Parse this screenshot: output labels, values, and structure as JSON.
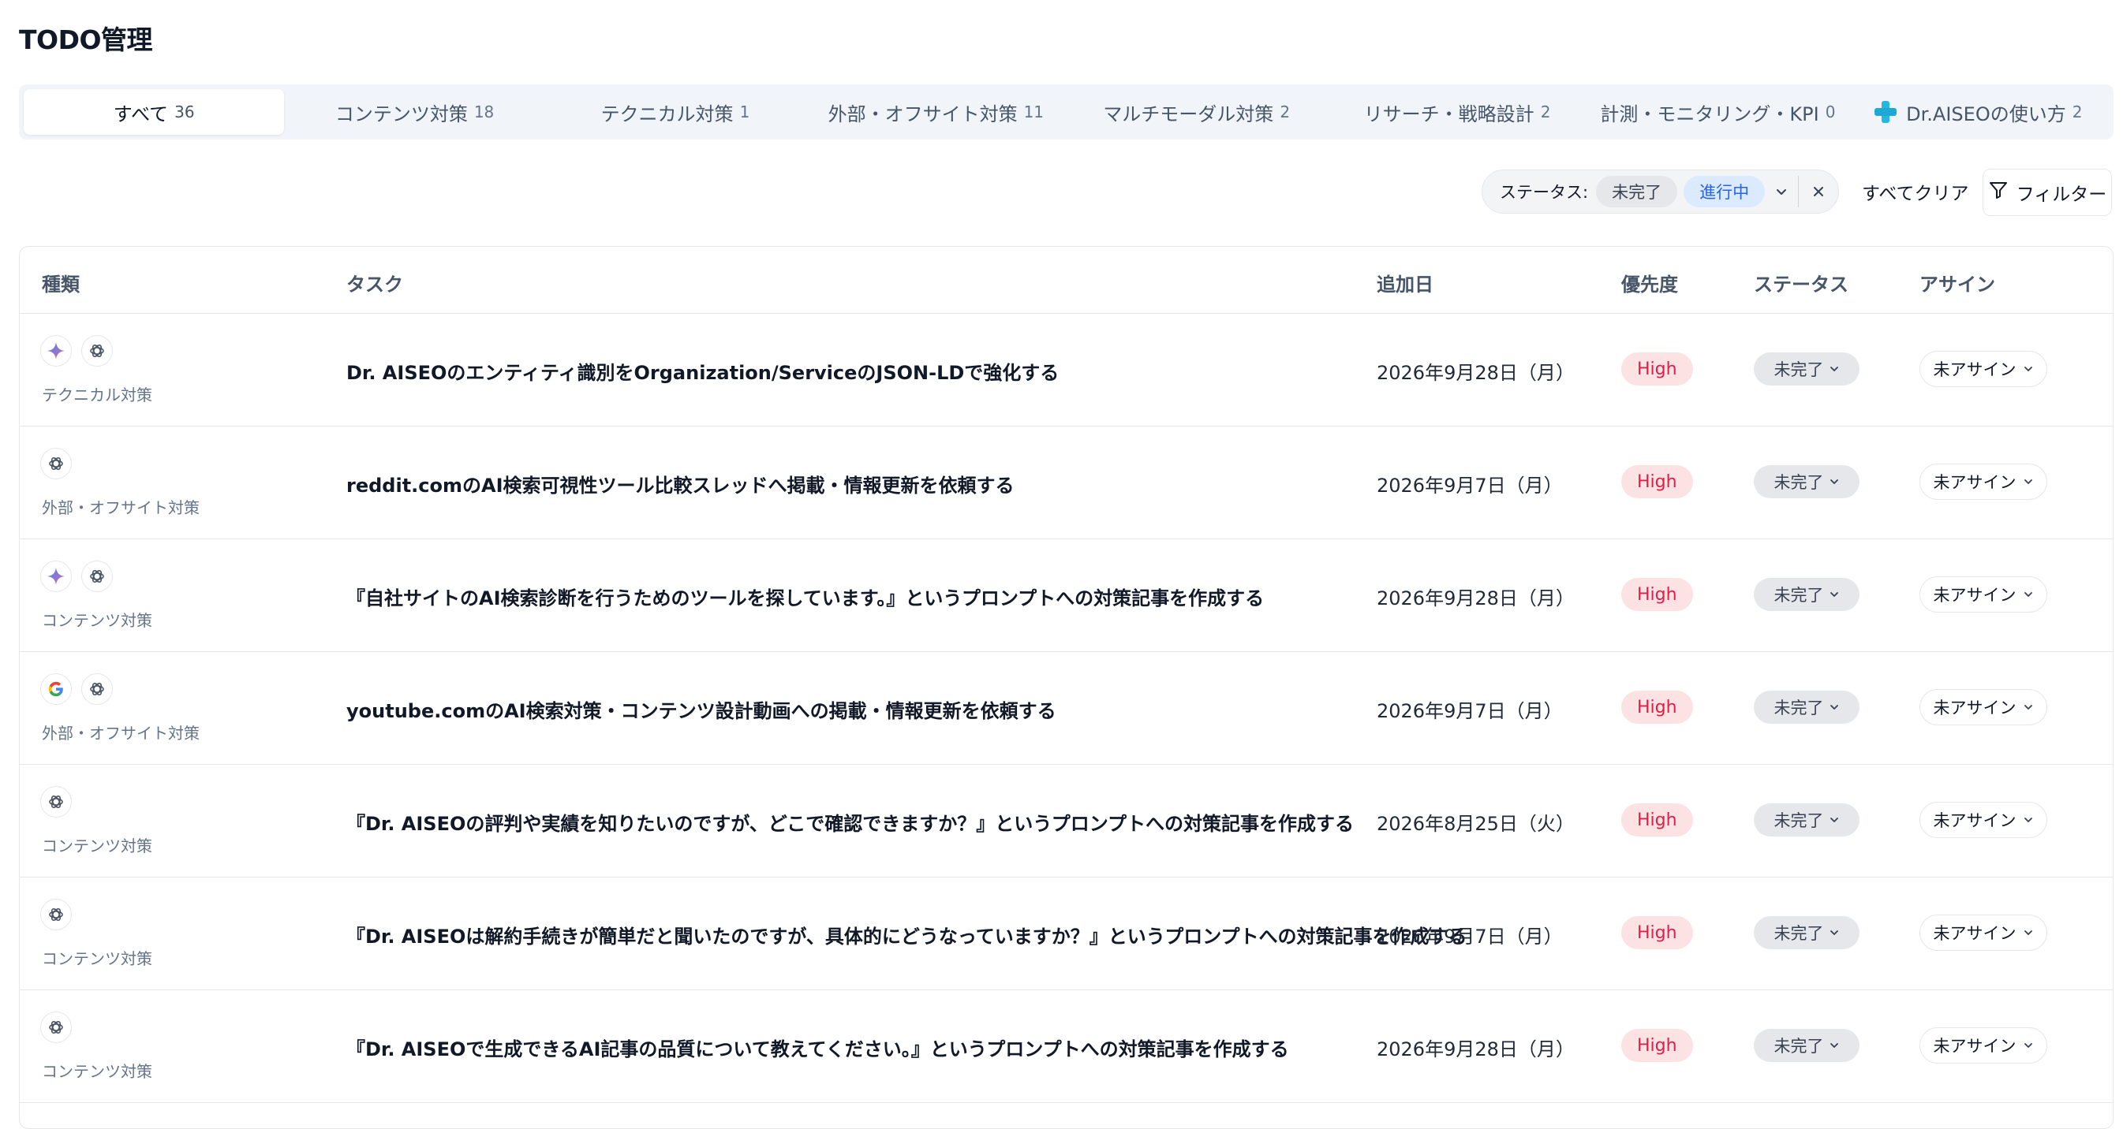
{
  "page": {
    "title": "TODO管理"
  },
  "tabs": [
    {
      "label": "すべて",
      "count": "36"
    },
    {
      "label": "コンテンツ対策",
      "count": "18"
    },
    {
      "label": "テクニカル対策",
      "count": "1"
    },
    {
      "label": "外部・オフサイト対策",
      "count": "11"
    },
    {
      "label": "マルチモーダル対策",
      "count": "2"
    },
    {
      "label": "リサーチ・戦略設計",
      "count": "2"
    },
    {
      "label": "計測・モニタリング・KPI",
      "count": "0"
    },
    {
      "label": "Dr.AISEOの使い方",
      "count": "2"
    }
  ],
  "filters": {
    "status_label": "ステータス:",
    "chips": [
      "未完了",
      "進行中"
    ],
    "clear_all": "すべてクリア",
    "filter_button": "フィルター"
  },
  "table": {
    "headers": {
      "type": "種類",
      "task": "タスク",
      "added": "追加日",
      "priority": "優先度",
      "status": "ステータス",
      "assign": "アサイン"
    },
    "rows": [
      {
        "type": "テクニカル対策",
        "icons": [
          "gemini-icon",
          "openai-icon"
        ],
        "task": "Dr. AISEOのエンティティ識別をOrganization/ServiceのJSON-LDで強化する",
        "date": "2026年9月28日（月）",
        "priority": "High",
        "status": "未完了",
        "assign": "未アサイン"
      },
      {
        "type": "外部・オフサイト対策",
        "icons": [
          "openai-icon"
        ],
        "task": "reddit.comのAI検索可視性ツール比較スレッドへ掲載・情報更新を依頼する",
        "date": "2026年9月7日（月）",
        "priority": "High",
        "status": "未完了",
        "assign": "未アサイン"
      },
      {
        "type": "コンテンツ対策",
        "icons": [
          "gemini-icon",
          "openai-icon"
        ],
        "task": "『自社サイトのAI検索診断を行うためのツールを探しています。』というプロンプトへの対策記事を作成する",
        "date": "2026年9月28日（月）",
        "priority": "High",
        "status": "未完了",
        "assign": "未アサイン"
      },
      {
        "type": "外部・オフサイト対策",
        "icons": [
          "google-icon",
          "openai-icon"
        ],
        "task": "youtube.comのAI検索対策・コンテンツ設計動画への掲載・情報更新を依頼する",
        "date": "2026年9月7日（月）",
        "priority": "High",
        "status": "未完了",
        "assign": "未アサイン"
      },
      {
        "type": "コンテンツ対策",
        "icons": [
          "openai-icon"
        ],
        "task": "『Dr. AISEOの評判や実績を知りたいのですが、どこで確認できますか？』というプロンプトへの対策記事を作成する",
        "date": "2026年8月25日（火）",
        "priority": "High",
        "status": "未完了",
        "assign": "未アサイン"
      },
      {
        "type": "コンテンツ対策",
        "icons": [
          "openai-icon"
        ],
        "task": "『Dr. AISEOは解約手続きが簡単だと聞いたのですが、具体的にどうなっていますか？』というプロンプトへの対策記事を作成する",
        "date": "2026年9月7日（月）",
        "priority": "High",
        "status": "未完了",
        "assign": "未アサイン"
      },
      {
        "type": "コンテンツ対策",
        "icons": [
          "openai-icon"
        ],
        "task": "『Dr. AISEOで生成できるAI記事の品質について教えてください。』というプロンプトへの対策記事を作成する",
        "date": "2026年9月28日（月）",
        "priority": "High",
        "status": "未完了",
        "assign": "未アサイン"
      }
    ]
  },
  "colors": {
    "priority_high_bg": "#fde2e4",
    "priority_high_text": "#e11d48",
    "chip_active_bg": "#dbeafe",
    "chip_active_text": "#2563eb"
  }
}
